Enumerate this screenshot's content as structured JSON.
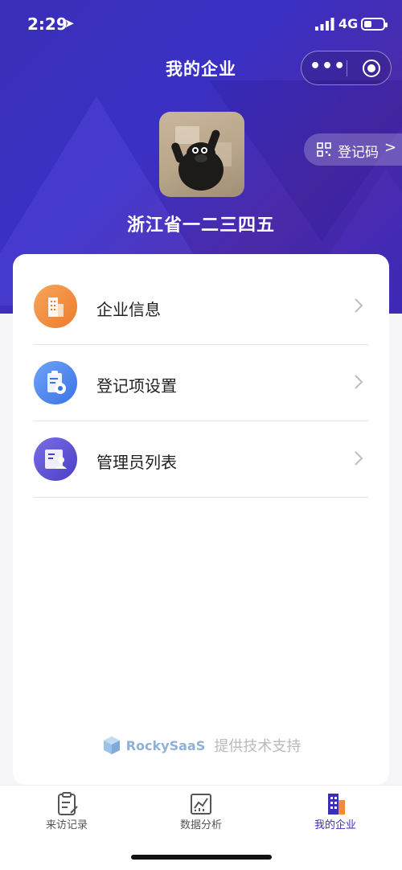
{
  "status_bar": {
    "time": "2:29",
    "network": "4G"
  },
  "header": {
    "title": "我的企业",
    "more": "•••"
  },
  "register_code": {
    "label": "登记码",
    "chevron": ">"
  },
  "company": {
    "name": "浙江省一二三四五"
  },
  "menu": [
    {
      "label": "企业信息",
      "icon": "building-icon",
      "color": "#f08a3c"
    },
    {
      "label": "登记项设置",
      "icon": "clipboard-settings-icon",
      "color": "#4c86ef"
    },
    {
      "label": "管理员列表",
      "icon": "admin-card-icon",
      "color": "#5a4fd3"
    }
  ],
  "footer": {
    "brand": "RockySaaS",
    "support": "提供技术支持"
  },
  "tabbar": [
    {
      "label": "来访记录",
      "icon": "visit-record-icon",
      "active": false
    },
    {
      "label": "数据分析",
      "icon": "data-analysis-icon",
      "active": false
    },
    {
      "label": "我的企业",
      "icon": "my-company-icon",
      "active": true
    }
  ],
  "colors": {
    "brand_purple": "#3b2fb5",
    "hero_bg": "#3a30c4"
  }
}
